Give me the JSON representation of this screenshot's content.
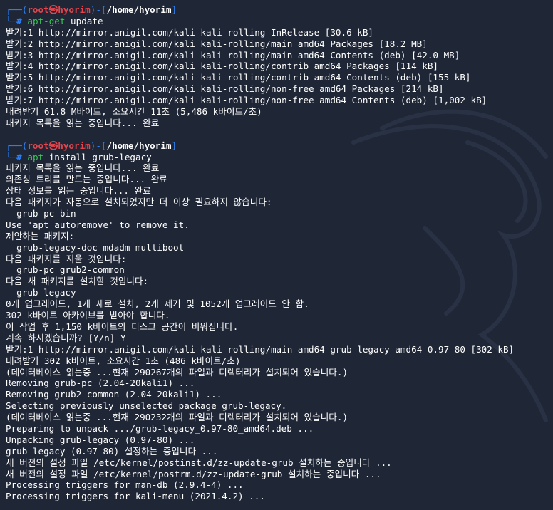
{
  "colors": {
    "background": "#1f2636",
    "prompt_frame": "#2f7ff0",
    "prompt_user": "#e8434a",
    "command": "#3cc75a"
  },
  "watermark": {
    "icon": "kali-dragon-icon"
  },
  "session1": {
    "prompt": {
      "user": "root㉿hyorim",
      "path": "/home/hyorim"
    },
    "command": {
      "name": "apt-get",
      "args": "update"
    },
    "output": [
      "받기:1 http://mirror.anigil.com/kali kali-rolling InRelease [30.6 kB]",
      "받기:2 http://mirror.anigil.com/kali kali-rolling/main amd64 Packages [18.2 MB]",
      "받기:3 http://mirror.anigil.com/kali kali-rolling/main amd64 Contents (deb) [42.0 MB]",
      "받기:4 http://mirror.anigil.com/kali kali-rolling/contrib amd64 Packages [114 kB]",
      "받기:5 http://mirror.anigil.com/kali kali-rolling/contrib amd64 Contents (deb) [155 kB]",
      "받기:6 http://mirror.anigil.com/kali kali-rolling/non-free amd64 Packages [214 kB]",
      "받기:7 http://mirror.anigil.com/kali kali-rolling/non-free amd64 Contents (deb) [1,002 kB]",
      "내려받기 61.8 M바이트, 소요시간 11초 (5,486 k바이트/초)",
      "패키지 목록을 읽는 중입니다... 완료"
    ]
  },
  "session2": {
    "prompt": {
      "user": "root㉿hyorim",
      "path": "/home/hyorim"
    },
    "command": {
      "name": "apt",
      "args": "install grub-legacy"
    },
    "output": [
      "패키지 목록을 읽는 중입니다... 완료",
      "의존성 트리를 만드는 중입니다... 완료",
      "상태 정보를 읽는 중입니다... 완료",
      "다음 패키지가 자동으로 설치되었지만 더 이상 필요하지 않습니다:",
      "  grub-pc-bin",
      "Use 'apt autoremove' to remove it.",
      "제안하는 패키지:",
      "  grub-legacy-doc mdadm multiboot",
      "다음 패키지를 지울 것입니다:",
      "  grub-pc grub2-common",
      "다음 새 패키지를 설치할 것입니다:",
      "  grub-legacy",
      "0개 업그레이드, 1개 새로 설치, 2개 제거 및 1052개 업그레이드 안 함.",
      "302 k바이트 아카이브를 받아야 합니다.",
      "이 작업 후 1,150 k바이트의 디스크 공간이 비워집니다.",
      "계속 하시겠습니까? [Y/n] Y",
      "받기:1 http://mirror.anigil.com/kali kali-rolling/main amd64 grub-legacy amd64 0.97-80 [302 kB]",
      "내려받기 302 k바이트, 소요시간 1초 (486 k바이트/초)",
      "(데이터베이스 읽는중 ...현재 290267개의 파일과 디렉터리가 설치되어 있습니다.)",
      "Removing grub-pc (2.04-20kali1) ...",
      "Removing grub2-common (2.04-20kali1) ...",
      "Selecting previously unselected package grub-legacy.",
      "(데이터베이스 읽는중 ...현재 290232개의 파일과 디렉터리가 설치되어 있습니다.)",
      "Preparing to unpack .../grub-legacy_0.97-80_amd64.deb ...",
      "Unpacking grub-legacy (0.97-80) ...",
      "grub-legacy (0.97-80) 설정하는 중입니다 ...",
      "새 버전의 설정 파일 /etc/kernel/postinst.d/zz-update-grub 설치하는 중입니다 ...",
      "새 버전의 설정 파일 /etc/kernel/postrm.d/zz-update-grub 설치하는 중입니다 ...",
      "Processing triggers for man-db (2.9.4-4) ...",
      "Processing triggers for kali-menu (2021.4.2) ..."
    ]
  }
}
